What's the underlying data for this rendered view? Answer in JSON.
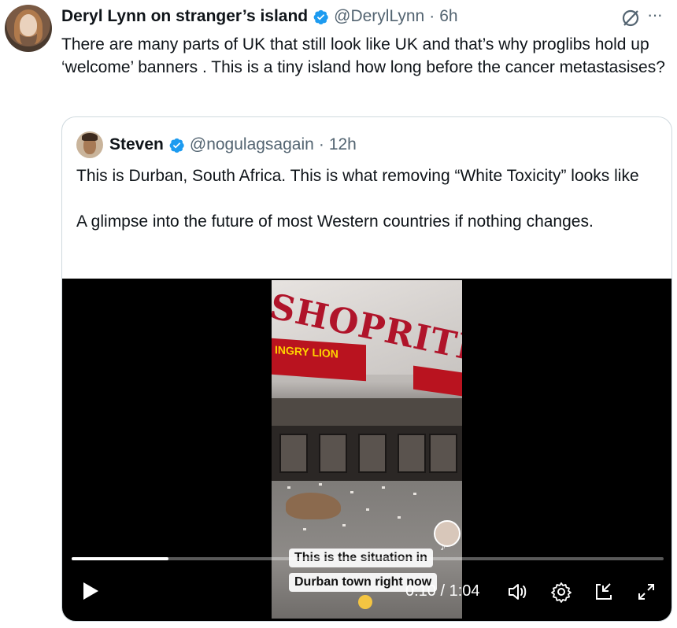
{
  "tweet": {
    "author_name": "Deryl Lynn on stranger’s island",
    "handle": "@DerylLynn",
    "separator": "·",
    "time": "6h",
    "text": "There are many parts of UK that still look like UK and that’s why proglibs hold up ‘welcome’ banners . This is a tiny island how long before the cancer metastasises?"
  },
  "quote": {
    "author_name": "Steven",
    "handle": "@nogulagsagain",
    "separator": "·",
    "time": "12h",
    "paragraph1": "This is Durban, South Africa. This is what removing “White Toxicity” looks like",
    "paragraph2": "A glimpse into the future of most Western countries if nothing changes."
  },
  "video": {
    "store_sign": "SHOPRITE",
    "banner_text_a": "INGRY",
    "banner_text_b": "LION",
    "caption_line1": "This is the situation in",
    "caption_line2": "Durban town right now",
    "timecode": "0:10 / 1:04",
    "progress": 0.163
  },
  "icons": {
    "verified": "verified-badge-icon",
    "grok": "grok-icon",
    "more": "more-icon",
    "play": "play-icon",
    "volume": "volume-icon",
    "settings": "settings-icon",
    "pip": "picture-in-picture-icon",
    "fullscreen": "fullscreen-icon"
  },
  "colors": {
    "verified_blue": "#1d9bf0",
    "secondary_text": "#536471",
    "border": "#cfd9de"
  }
}
